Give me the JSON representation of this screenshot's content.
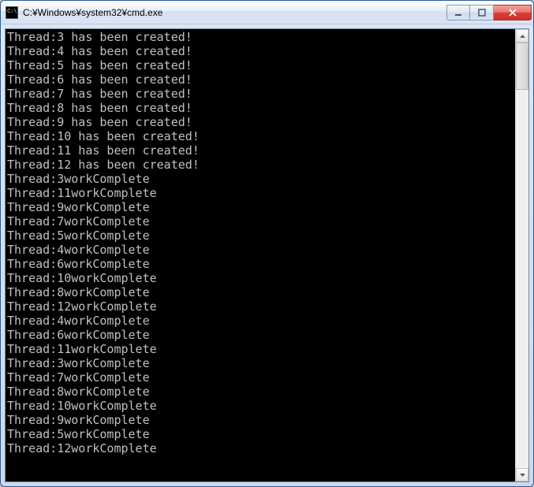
{
  "window": {
    "title": "C:¥Windows¥system32¥cmd.exe"
  },
  "console": {
    "lines": [
      "Thread:3 has been created!",
      "Thread:4 has been created!",
      "Thread:5 has been created!",
      "Thread:6 has been created!",
      "Thread:7 has been created!",
      "Thread:8 has been created!",
      "Thread:9 has been created!",
      "Thread:10 has been created!",
      "Thread:11 has been created!",
      "Thread:12 has been created!",
      "Thread:3workComplete",
      "Thread:11workComplete",
      "Thread:9workComplete",
      "Thread:7workComplete",
      "Thread:5workComplete",
      "Thread:4workComplete",
      "Thread:6workComplete",
      "Thread:10workComplete",
      "Thread:8workComplete",
      "Thread:12workComplete",
      "Thread:4workComplete",
      "Thread:6workComplete",
      "Thread:11workComplete",
      "Thread:3workComplete",
      "Thread:7workComplete",
      "Thread:8workComplete",
      "Thread:10workComplete",
      "Thread:9workComplete",
      "Thread:5workComplete",
      "Thread:12workComplete"
    ]
  }
}
